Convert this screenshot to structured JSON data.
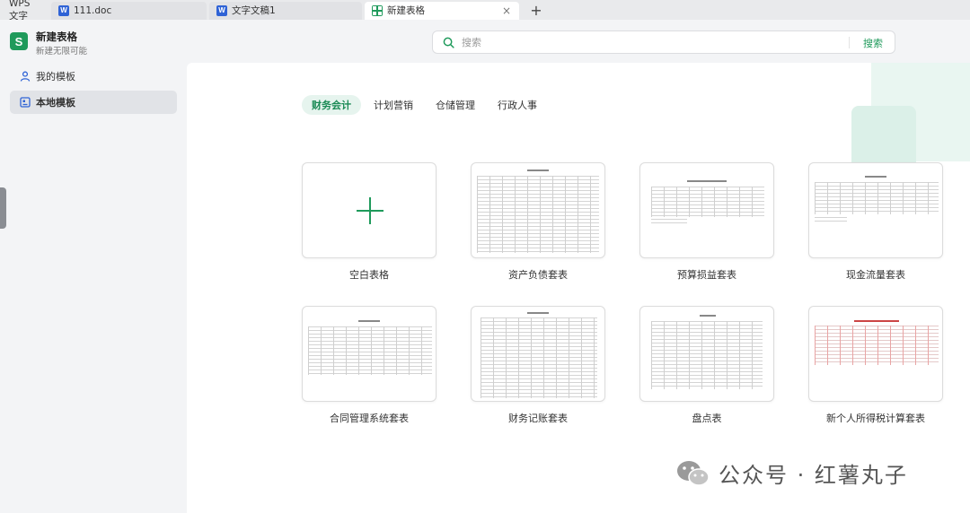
{
  "tabs": {
    "home_label": "WPS 文字",
    "doc1_label": "111.doc",
    "doc2_label": "文字文稿1",
    "active_label": "新建表格",
    "doc_icon_glyph": "W",
    "sheet_icon_glyph": "S",
    "close_glyph": "×",
    "new_tab_glyph": "+"
  },
  "app": {
    "logo_glyph": "S",
    "title": "新建表格",
    "subtitle": "新建无限可能"
  },
  "search": {
    "placeholder": "搜索",
    "value": "",
    "button_label": "搜索",
    "icon": "search-icon"
  },
  "sidebar": {
    "items": [
      {
        "label": "我的模板",
        "icon": "user-icon",
        "active": false
      },
      {
        "label": "本地模板",
        "icon": "local-template-icon",
        "active": true
      }
    ]
  },
  "categories": [
    {
      "label": "财务会计",
      "active": true
    },
    {
      "label": "计划营销",
      "active": false
    },
    {
      "label": "仓储管理",
      "active": false
    },
    {
      "label": "行政人事",
      "active": false
    }
  ],
  "templates": [
    {
      "label": "空白表格"
    },
    {
      "label": "资产负债套表"
    },
    {
      "label": "预算损益套表"
    },
    {
      "label": "现金流量套表"
    },
    {
      "label": "合同管理系统套表"
    },
    {
      "label": "财务记账套表"
    },
    {
      "label": "盘点表"
    },
    {
      "label": "新个人所得税计算套表"
    }
  ],
  "watermark": {
    "text": "公众号 · 红薯丸子"
  },
  "colors": {
    "accent": "#1f9a5b",
    "accent_text": "#1a8a55",
    "accent_bg": "#e6f4ee",
    "word_blue": "#2f63d6"
  }
}
